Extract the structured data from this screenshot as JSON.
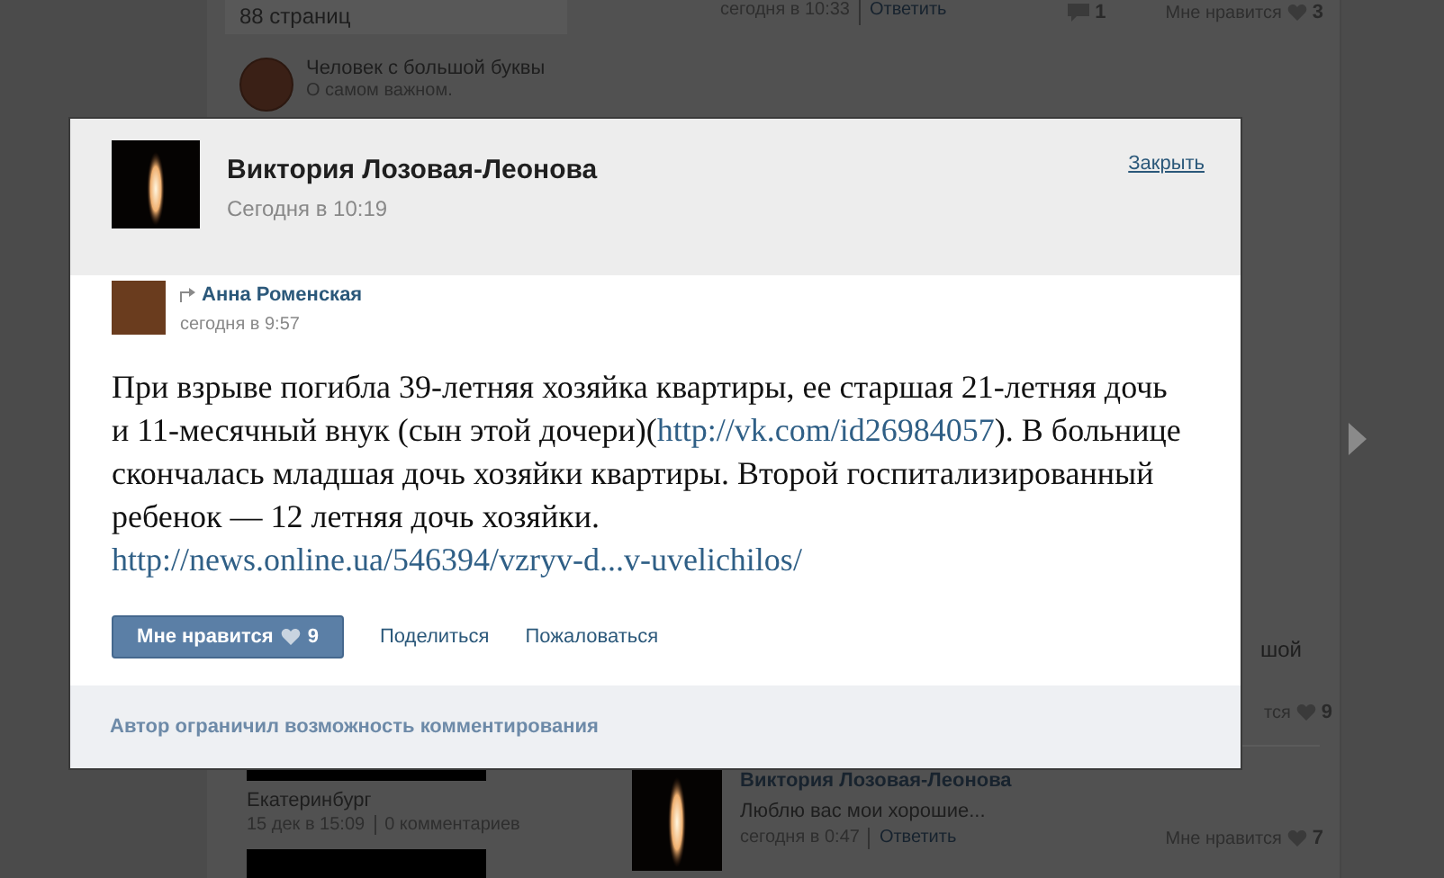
{
  "background_page": {
    "left_column": {
      "pages_box": {
        "text": "88 страниц"
      },
      "group": {
        "title": "Человек с большой буквы",
        "subtitle": "О самом важном."
      },
      "photo_item": {
        "city": "Екатеринбург",
        "date": "15 дек в 15:09",
        "comments": "0 комментариев"
      }
    },
    "right_column": {
      "top_comment": {
        "date": "сегодня в 10:33",
        "reply": "Ответить",
        "reply_count": "1",
        "like_label": "Мне нравится",
        "like_count": "3"
      },
      "cut_text": "шой",
      "cut_like": {
        "label": "тся",
        "count": "9"
      },
      "post": {
        "author": "Виктория Лозовая-Леонова",
        "text": "Люблю вас мои хорошие...",
        "date": "сегодня в 0:47",
        "reply": "Ответить",
        "like_label": "Мне нравится",
        "like_count": "7"
      }
    }
  },
  "modal": {
    "author": "Виктория Лозовая-Леонова",
    "date": "Сегодня в 10:19",
    "close": "Закрыть",
    "repost": {
      "author": "Анна Роменская",
      "date": "сегодня в 9:57",
      "text_parts": [
        {
          "kind": "text",
          "text": "При взрыве погибла 39-летняя хозяйка квартиры, ее старшая 21-летняя дочь и 11-месячный внук (сын этой дочери)("
        },
        {
          "kind": "link",
          "text": "http://vk.com/id26984057"
        },
        {
          "kind": "text",
          "text": "). В больнице скончалась младшая дочь хозяйки квартиры. Второй госпитализированный ребенок — 12 летняя дочь хозяйки."
        }
      ],
      "url": "http://news.online.ua/546394/vzryv-d...v-uvelichilos/"
    },
    "like_button": {
      "label": "Мне нравится",
      "count": "9"
    },
    "actions": [
      "Поделиться",
      "Пожаловаться"
    ],
    "footer": "Автор ограничил возможность комментирования"
  }
}
